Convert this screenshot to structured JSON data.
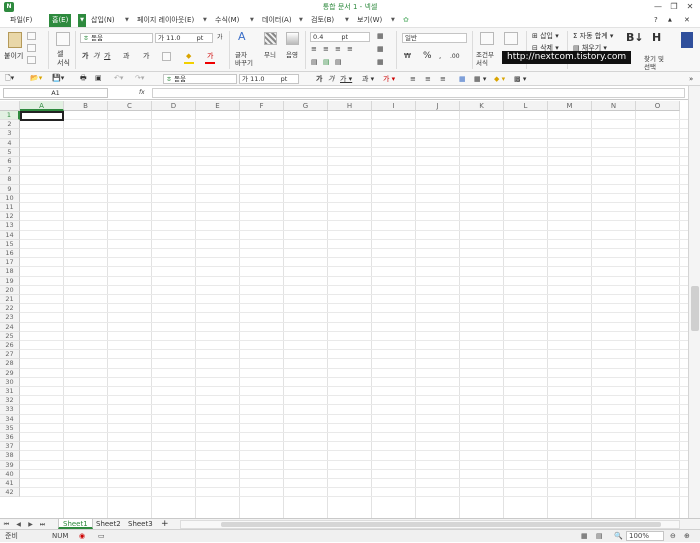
{
  "app": {
    "title": "통합 문서 1 - 넥셀",
    "icon_letter": "N"
  },
  "window_controls": {
    "minimize": "—",
    "restore": "❐",
    "close": "✕"
  },
  "menu": {
    "items": [
      "파일(F)",
      "홈(E)",
      "삽입(N)",
      "페이지 레이아웃(E)",
      "수식(M)",
      "데이터(A)",
      "검토(B)",
      "보기(W)"
    ],
    "active_index": 1,
    "right_icons": [
      "?",
      "▲",
      "✕"
    ]
  },
  "ribbon": {
    "paste_label": "붙이기",
    "cell_format_label": "셀\n서식",
    "font_name": "돋움",
    "font_size": "11.0",
    "font_unit": "pt",
    "bold": "가",
    "italic": "가",
    "underline": "가",
    "strike": "과",
    "char_label": "가",
    "text_wrap_label": "글자\n바꾸기",
    "fill_label": "무늬",
    "format_label": "음영",
    "line_width": "0.4",
    "line_unit": "pt",
    "number_format": "일반",
    "currency": "₩",
    "percent": "%",
    "conditional_label": "조건부\n서식",
    "insert_label": "삽입",
    "delete_label": "삭제",
    "sum_label": "자동 합계",
    "fill2_label": "채우기",
    "sort_label": "정렬",
    "find_label": "찾기 및\n선택"
  },
  "watermark": "http://nextcom.tistory.com",
  "toolbar2": {
    "font_name": "돋움",
    "font_size": "11.0",
    "font_unit": "pt"
  },
  "formula_bar": {
    "cell_ref": "A1",
    "fx": "fx",
    "value": ""
  },
  "columns": [
    "A",
    "B",
    "C",
    "D",
    "E",
    "F",
    "G",
    "H",
    "I",
    "J",
    "K",
    "L",
    "M",
    "N",
    "O"
  ],
  "rows": [
    1,
    2,
    3,
    4,
    5,
    6,
    7,
    8,
    9,
    10,
    11,
    12,
    13,
    14,
    15,
    16,
    17,
    18,
    19,
    20,
    21,
    22,
    23,
    24,
    25,
    26,
    27,
    28,
    29,
    30,
    31,
    32,
    33,
    34,
    35,
    36,
    37,
    38,
    39,
    40,
    41,
    42
  ],
  "active_cell": {
    "col": "A",
    "row": 1
  },
  "sheets": {
    "tabs": [
      "Sheet1",
      "Sheet2",
      "Sheet3"
    ],
    "active_index": 0,
    "add": "+"
  },
  "status": {
    "mode": "준비",
    "num": "NUM",
    "zoom": "100%"
  }
}
